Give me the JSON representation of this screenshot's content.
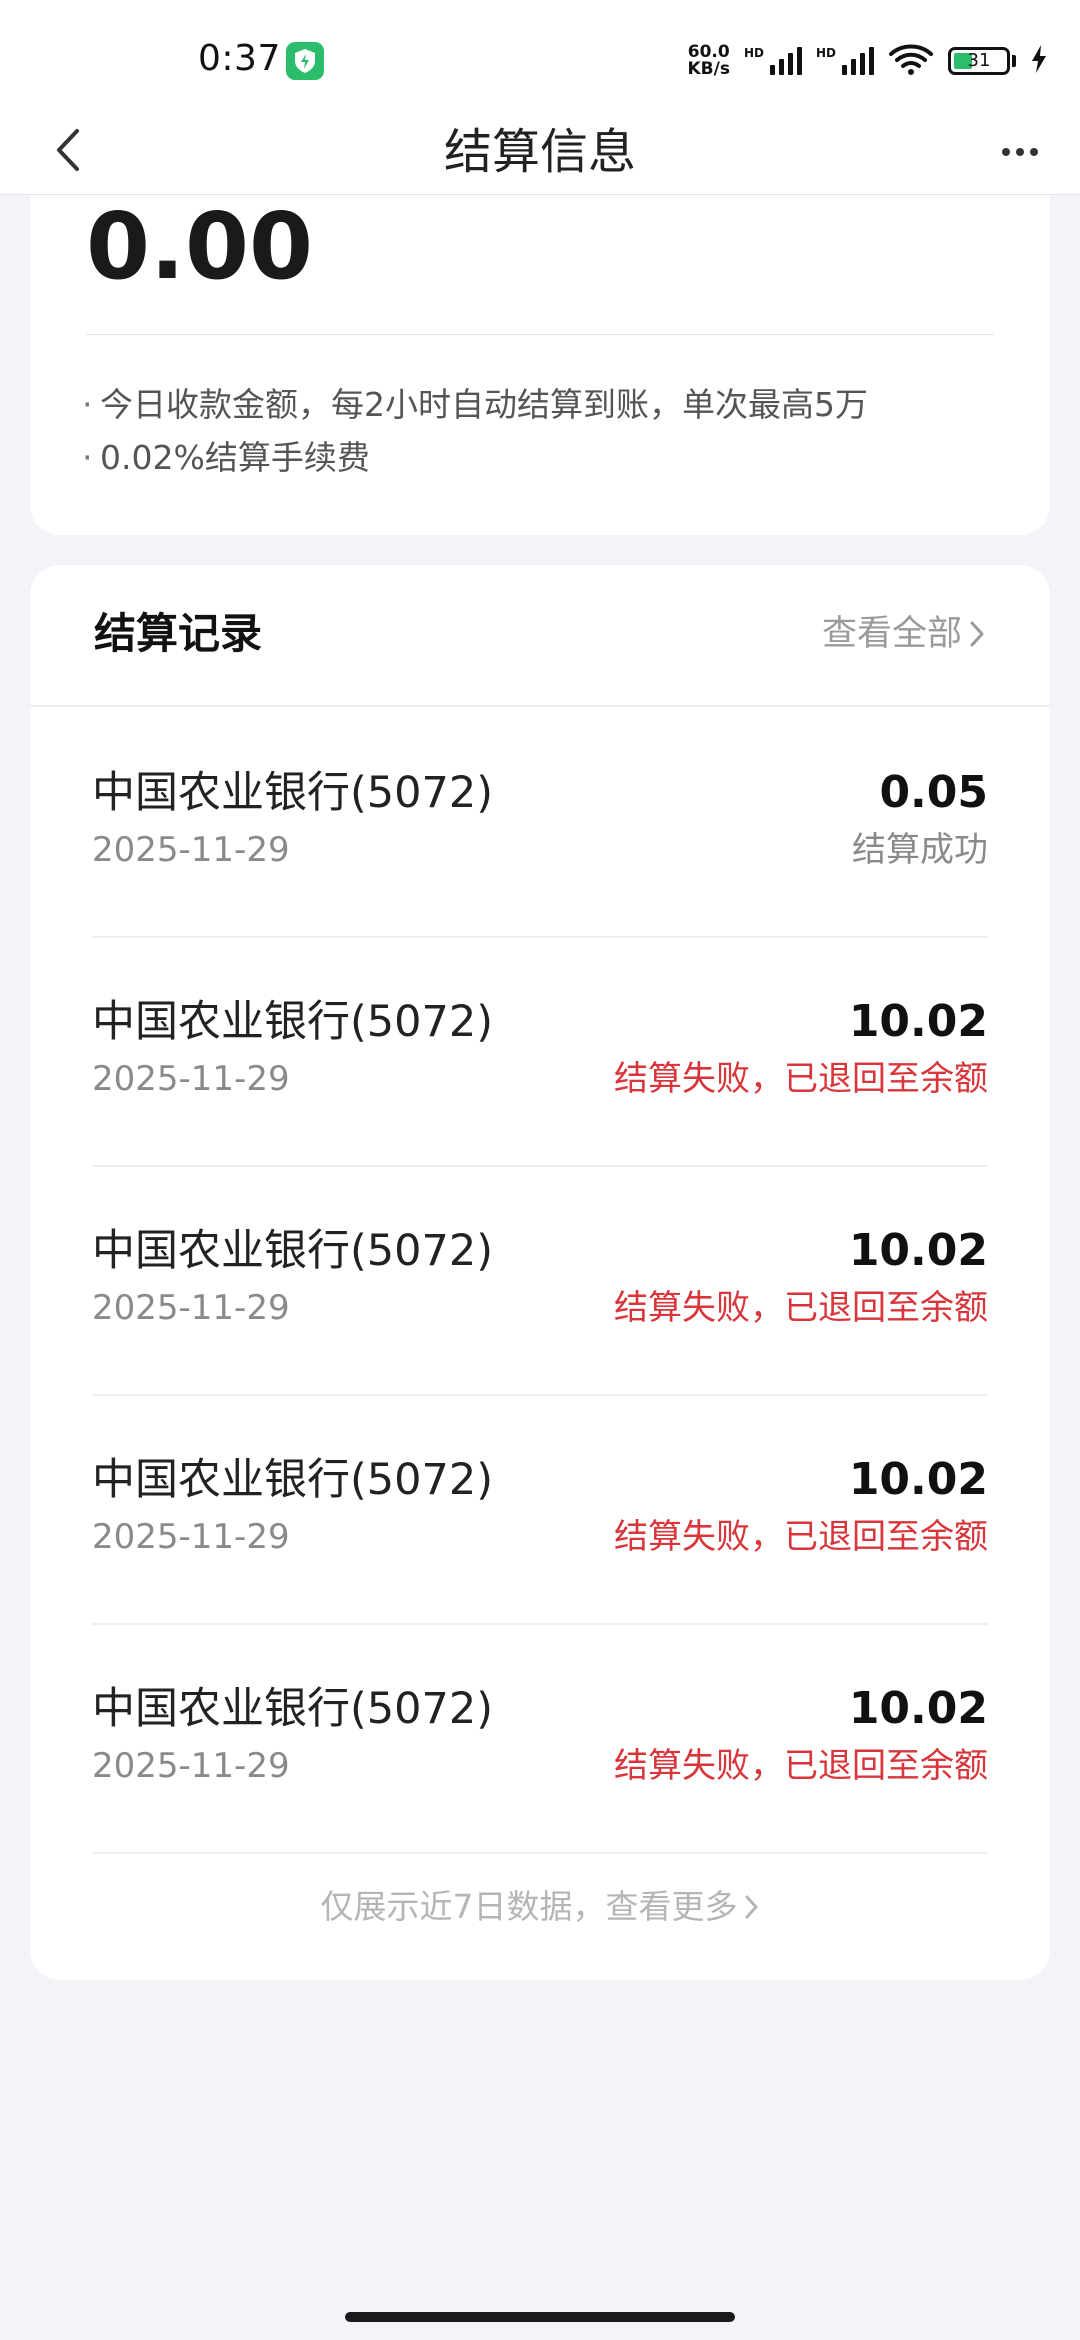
{
  "status_bar": {
    "time": "0:37",
    "net_speed_value": "60.0",
    "net_speed_unit": "KB/s",
    "hd_label_1": "HD",
    "hd_label_2": "HD",
    "battery_level": "31",
    "icons": [
      "shield-app-icon",
      "signal-icon",
      "signal-icon",
      "wifi-icon",
      "battery-icon",
      "charging-icon"
    ]
  },
  "nav": {
    "title": "结算信息",
    "back_icon": "chevron-left-icon",
    "more_icon": "more-dots-icon"
  },
  "summary": {
    "amount": "0.00",
    "notes": [
      "今日收款金额，每2小时自动结算到账，单次最高5万",
      "0.02%结算手续费"
    ]
  },
  "records": {
    "title": "结算记录",
    "view_all_label": "查看全部",
    "items": [
      {
        "bank": "中国农业银行(5072)",
        "date": "2025-11-29",
        "amount": "0.05",
        "status": "结算成功",
        "status_type": "success"
      },
      {
        "bank": "中国农业银行(5072)",
        "date": "2025-11-29",
        "amount": "10.02",
        "status": "结算失败，已退回至余额",
        "status_type": "fail"
      },
      {
        "bank": "中国农业银行(5072)",
        "date": "2025-11-29",
        "amount": "10.02",
        "status": "结算失败，已退回至余额",
        "status_type": "fail"
      },
      {
        "bank": "中国农业银行(5072)",
        "date": "2025-11-29",
        "amount": "10.02",
        "status": "结算失败，已退回至余额",
        "status_type": "fail"
      },
      {
        "bank": "中国农业银行(5072)",
        "date": "2025-11-29",
        "amount": "10.02",
        "status": "结算失败，已退回至余额",
        "status_type": "fail"
      }
    ],
    "footer_label": "仅展示近7日数据，查看更多"
  },
  "colors": {
    "background": "#f3f4f8",
    "fail": "#d8363a",
    "accent_green": "#2bbd6b"
  }
}
